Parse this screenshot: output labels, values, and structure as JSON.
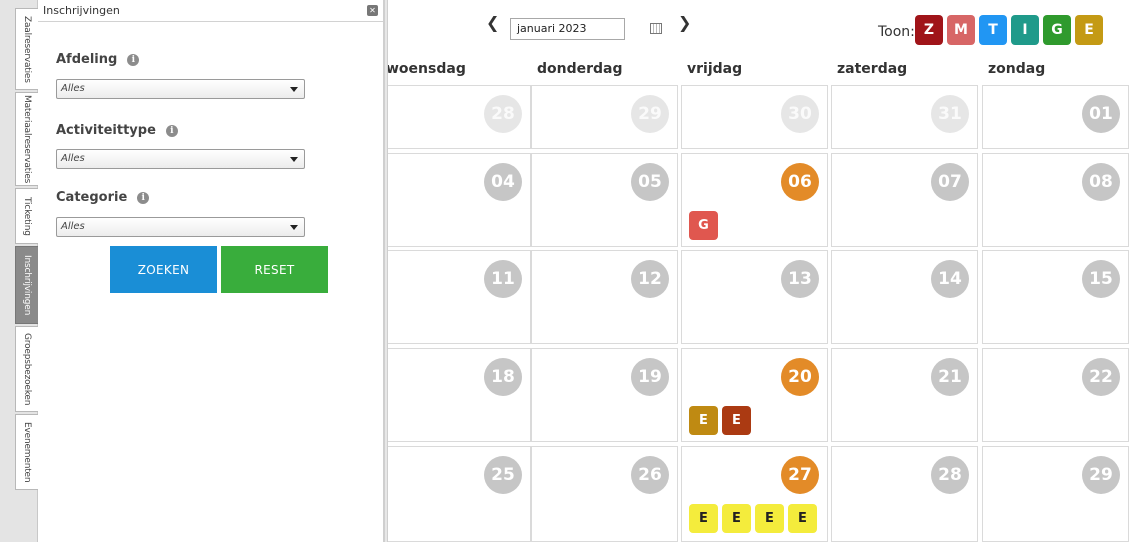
{
  "side_tabs": [
    {
      "label": "Zaalreservaties",
      "active": false
    },
    {
      "label": "Materiaalreservaties",
      "active": false
    },
    {
      "label": "Ticketing",
      "active": false
    },
    {
      "label": "Inschrijvingen",
      "active": true
    },
    {
      "label": "Groepsbezoeken",
      "active": false
    },
    {
      "label": "Evenementen",
      "active": false
    }
  ],
  "panel": {
    "title": "Inschrijvingen",
    "close_icon": "close-icon",
    "filters": [
      {
        "label": "Afdeling",
        "value": "Alles"
      },
      {
        "label": "Activiteittype",
        "value": "Alles"
      },
      {
        "label": "Categorie",
        "value": "Alles"
      }
    ],
    "search_label": "ZOEKEN",
    "reset_label": "RESET"
  },
  "calendar": {
    "month": "januari 2023",
    "show_label": "Toon:",
    "legend": [
      {
        "label": "Z",
        "color": "#a01419"
      },
      {
        "label": "M",
        "color": "#d76666"
      },
      {
        "label": "T",
        "color": "#2196f3"
      },
      {
        "label": "I",
        "color": "#1f9a8a"
      },
      {
        "label": "G",
        "color": "#2f9a2d"
      },
      {
        "label": "E",
        "color": "#c49a14"
      }
    ],
    "weekdays": [
      "woensdag",
      "donderdag",
      "vrijdag",
      "zaterdag",
      "zondag"
    ],
    "weeks": [
      {
        "info": false,
        "days": [
          {
            "num": "28",
            "state": "muted",
            "events": []
          },
          {
            "num": "29",
            "state": "muted",
            "events": []
          },
          {
            "num": "30",
            "state": "muted",
            "events": []
          },
          {
            "num": "31",
            "state": "muted",
            "events": []
          },
          {
            "num": "01",
            "state": "normal",
            "events": []
          }
        ]
      },
      {
        "info": true,
        "days": [
          {
            "num": "04",
            "state": "normal",
            "events": []
          },
          {
            "num": "05",
            "state": "normal",
            "events": []
          },
          {
            "num": "06",
            "state": "busy",
            "events": [
              {
                "label": "G",
                "color": "#e0574f"
              }
            ]
          },
          {
            "num": "07",
            "state": "normal",
            "events": []
          },
          {
            "num": "08",
            "state": "normal",
            "events": []
          }
        ]
      },
      {
        "info": true,
        "days": [
          {
            "num": "11",
            "state": "normal",
            "events": []
          },
          {
            "num": "12",
            "state": "normal",
            "events": []
          },
          {
            "num": "13",
            "state": "normal",
            "events": []
          },
          {
            "num": "14",
            "state": "normal",
            "events": []
          },
          {
            "num": "15",
            "state": "normal",
            "events": []
          }
        ]
      },
      {
        "info": true,
        "days": [
          {
            "num": "18",
            "state": "normal",
            "events": []
          },
          {
            "num": "19",
            "state": "normal",
            "events": []
          },
          {
            "num": "20",
            "state": "busy",
            "events": [
              {
                "label": "E",
                "color": "#bf8a12"
              },
              {
                "label": "E",
                "color": "#ab3a12"
              }
            ]
          },
          {
            "num": "21",
            "state": "normal",
            "events": []
          },
          {
            "num": "22",
            "state": "normal",
            "events": []
          }
        ]
      },
      {
        "info": true,
        "days": [
          {
            "num": "25",
            "state": "normal",
            "events": []
          },
          {
            "num": "26",
            "state": "normal",
            "events": []
          },
          {
            "num": "27",
            "state": "busy",
            "events": [
              {
                "label": "E",
                "color": "#f4ec3c"
              },
              {
                "label": "E",
                "color": "#f4ec3c"
              },
              {
                "label": "E",
                "color": "#f4ec3c"
              },
              {
                "label": "E",
                "color": "#f4ec3c"
              }
            ]
          },
          {
            "num": "28",
            "state": "normal",
            "events": []
          },
          {
            "num": "29",
            "state": "normal",
            "events": []
          }
        ]
      }
    ]
  }
}
